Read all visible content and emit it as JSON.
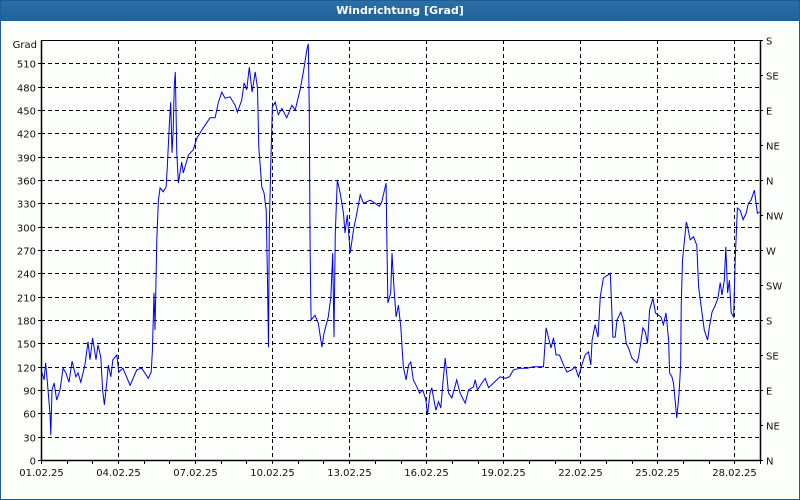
{
  "window": {
    "title": "Windrichtung [Grad]"
  },
  "chart_data": {
    "type": "line",
    "title": "Windrichtung [Grad]",
    "ylabel": "Grad",
    "ylim": [
      0,
      540
    ],
    "yticks": [
      0,
      30,
      60,
      90,
      120,
      150,
      180,
      210,
      240,
      270,
      300,
      330,
      360,
      390,
      420,
      450,
      480,
      510
    ],
    "y2ticks": [
      {
        "value": 0,
        "label": "N"
      },
      {
        "value": 45,
        "label": "NE"
      },
      {
        "value": 90,
        "label": "E"
      },
      {
        "value": 135,
        "label": "SE"
      },
      {
        "value": 180,
        "label": "S"
      },
      {
        "value": 225,
        "label": "SW"
      },
      {
        "value": 270,
        "label": "W"
      },
      {
        "value": 315,
        "label": "NW"
      },
      {
        "value": 360,
        "label": "N"
      },
      {
        "value": 405,
        "label": "NE"
      },
      {
        "value": 450,
        "label": "E"
      },
      {
        "value": 495,
        "label": "SE"
      },
      {
        "value": 540,
        "label": "S"
      }
    ],
    "xlim_days": [
      0,
      28
    ],
    "xticks": [
      {
        "day": 0,
        "label": "01.02.25"
      },
      {
        "day": 3,
        "label": "04.02.25"
      },
      {
        "day": 6,
        "label": "07.02.25"
      },
      {
        "day": 9,
        "label": "10.02.25"
      },
      {
        "day": 12,
        "label": "13.02.25"
      },
      {
        "day": 15,
        "label": "16.02.25"
      },
      {
        "day": 18,
        "label": "19.02.25"
      },
      {
        "day": 21,
        "label": "22.02.25"
      },
      {
        "day": 24,
        "label": "25.02.25"
      },
      {
        "day": 27,
        "label": "28.02.25"
      }
    ],
    "grid": true,
    "line_color": "#0000ee",
    "series": [
      {
        "name": "Windrichtung",
        "points": [
          [
            0.03,
            113
          ],
          [
            0.12,
            103
          ],
          [
            0.18,
            125
          ],
          [
            0.23,
            107
          ],
          [
            0.35,
            60
          ],
          [
            0.38,
            32
          ],
          [
            0.43,
            90
          ],
          [
            0.51,
            99
          ],
          [
            0.61,
            77
          ],
          [
            0.74,
            90
          ],
          [
            0.86,
            118
          ],
          [
            0.97,
            112
          ],
          [
            1.09,
            100
          ],
          [
            1.21,
            127
          ],
          [
            1.36,
            107
          ],
          [
            1.44,
            112
          ],
          [
            1.55,
            100
          ],
          [
            1.71,
            122
          ],
          [
            1.83,
            152
          ],
          [
            1.91,
            129
          ],
          [
            2.01,
            157
          ],
          [
            2.14,
            129
          ],
          [
            2.22,
            148
          ],
          [
            2.33,
            132
          ],
          [
            2.4,
            90
          ],
          [
            2.47,
            71
          ],
          [
            2.56,
            99
          ],
          [
            2.62,
            122
          ],
          [
            2.72,
            107
          ],
          [
            2.8,
            129
          ],
          [
            2.95,
            135
          ],
          [
            3.03,
            113
          ],
          [
            3.19,
            118
          ],
          [
            3.47,
            96
          ],
          [
            3.73,
            116
          ],
          [
            3.92,
            118
          ],
          [
            4.18,
            105
          ],
          [
            4.29,
            113
          ],
          [
            4.34,
            141
          ],
          [
            4.4,
            215
          ],
          [
            4.44,
            167
          ],
          [
            4.51,
            283
          ],
          [
            4.57,
            334
          ],
          [
            4.64,
            350
          ],
          [
            4.76,
            345
          ],
          [
            4.87,
            351
          ],
          [
            4.92,
            377
          ],
          [
            5.0,
            433
          ],
          [
            5.05,
            460
          ],
          [
            5.1,
            395
          ],
          [
            5.15,
            424
          ],
          [
            5.19,
            482
          ],
          [
            5.23,
            499
          ],
          [
            5.29,
            395
          ],
          [
            5.35,
            356
          ],
          [
            5.48,
            383
          ],
          [
            5.54,
            369
          ],
          [
            5.74,
            392
          ],
          [
            5.93,
            399
          ],
          [
            6.07,
            414
          ],
          [
            6.32,
            427
          ],
          [
            6.58,
            440
          ],
          [
            6.78,
            440
          ],
          [
            6.91,
            460
          ],
          [
            7.04,
            473
          ],
          [
            7.17,
            465
          ],
          [
            7.36,
            467
          ],
          [
            7.56,
            456
          ],
          [
            7.65,
            447
          ],
          [
            7.82,
            463
          ],
          [
            7.91,
            485
          ],
          [
            8.01,
            476
          ],
          [
            8.11,
            505
          ],
          [
            8.22,
            473
          ],
          [
            8.34,
            499
          ],
          [
            8.43,
            478
          ],
          [
            8.48,
            402
          ],
          [
            8.6,
            351
          ],
          [
            8.69,
            343
          ],
          [
            8.77,
            321
          ],
          [
            8.82,
            231
          ],
          [
            8.86,
            145
          ],
          [
            8.89,
            300
          ],
          [
            8.95,
            382
          ],
          [
            9.01,
            454
          ],
          [
            9.12,
            460
          ],
          [
            9.24,
            444
          ],
          [
            9.38,
            452
          ],
          [
            9.57,
            440
          ],
          [
            9.77,
            456
          ],
          [
            9.9,
            450
          ],
          [
            10.09,
            476
          ],
          [
            10.22,
            499
          ],
          [
            10.35,
            527
          ],
          [
            10.41,
            535
          ],
          [
            10.45,
            446
          ],
          [
            10.48,
            270
          ],
          [
            10.52,
            180
          ],
          [
            10.67,
            186
          ],
          [
            10.8,
            176
          ],
          [
            10.94,
            145
          ],
          [
            11.02,
            163
          ],
          [
            11.19,
            184
          ],
          [
            11.29,
            210
          ],
          [
            11.36,
            266
          ],
          [
            11.41,
            158
          ],
          [
            11.46,
            292
          ],
          [
            11.54,
            360
          ],
          [
            11.65,
            343
          ],
          [
            11.78,
            317
          ],
          [
            11.84,
            292
          ],
          [
            11.93,
            315
          ],
          [
            12.04,
            266
          ],
          [
            12.17,
            296
          ],
          [
            12.32,
            321
          ],
          [
            12.43,
            341
          ],
          [
            12.56,
            330
          ],
          [
            12.82,
            334
          ],
          [
            13.01,
            330
          ],
          [
            13.18,
            326
          ],
          [
            13.27,
            332
          ],
          [
            13.36,
            345
          ],
          [
            13.44,
            356
          ],
          [
            13.47,
            279
          ],
          [
            13.51,
            202
          ],
          [
            13.62,
            215
          ],
          [
            13.67,
            266
          ],
          [
            13.75,
            219
          ],
          [
            13.83,
            184
          ],
          [
            13.92,
            199
          ],
          [
            14.01,
            171
          ],
          [
            14.11,
            120
          ],
          [
            14.22,
            103
          ],
          [
            14.31,
            122
          ],
          [
            14.4,
            126
          ],
          [
            14.5,
            103
          ],
          [
            14.64,
            94
          ],
          [
            14.74,
            86
          ],
          [
            14.87,
            90
          ],
          [
            14.99,
            77
          ],
          [
            15.05,
            58
          ],
          [
            15.15,
            86
          ],
          [
            15.22,
            93
          ],
          [
            15.28,
            81
          ],
          [
            15.38,
            64
          ],
          [
            15.48,
            75
          ],
          [
            15.57,
            67
          ],
          [
            15.65,
            99
          ],
          [
            15.74,
            131
          ],
          [
            15.87,
            86
          ],
          [
            16.0,
            80
          ],
          [
            16.19,
            103
          ],
          [
            16.32,
            86
          ],
          [
            16.52,
            73
          ],
          [
            16.65,
            90
          ],
          [
            16.84,
            94
          ],
          [
            16.91,
            103
          ],
          [
            17.0,
            90
          ],
          [
            17.17,
            99
          ],
          [
            17.3,
            105
          ],
          [
            17.43,
            93
          ],
          [
            17.62,
            99
          ],
          [
            17.88,
            107
          ],
          [
            18.08,
            105
          ],
          [
            18.24,
            107
          ],
          [
            18.4,
            116
          ],
          [
            18.66,
            118
          ],
          [
            18.92,
            118
          ],
          [
            19.18,
            120
          ],
          [
            19.44,
            120
          ],
          [
            19.57,
            120
          ],
          [
            19.67,
            170
          ],
          [
            19.76,
            158
          ],
          [
            19.86,
            144
          ],
          [
            19.96,
            157
          ],
          [
            20.06,
            135
          ],
          [
            20.19,
            135
          ],
          [
            20.35,
            122
          ],
          [
            20.48,
            113
          ],
          [
            20.67,
            116
          ],
          [
            20.8,
            120
          ],
          [
            20.93,
            107
          ],
          [
            21.06,
            122
          ],
          [
            21.19,
            135
          ],
          [
            21.32,
            139
          ],
          [
            21.41,
            122
          ],
          [
            21.46,
            154
          ],
          [
            21.58,
            174
          ],
          [
            21.69,
            158
          ],
          [
            21.78,
            210
          ],
          [
            21.9,
            234
          ],
          [
            22.17,
            240
          ],
          [
            22.27,
            158
          ],
          [
            22.36,
            158
          ],
          [
            22.43,
            180
          ],
          [
            22.58,
            190
          ],
          [
            22.68,
            180
          ],
          [
            22.79,
            150
          ],
          [
            22.88,
            144
          ],
          [
            23.01,
            131
          ],
          [
            23.21,
            125
          ],
          [
            23.27,
            132
          ],
          [
            23.36,
            152
          ],
          [
            23.44,
            170
          ],
          [
            23.53,
            165
          ],
          [
            23.62,
            150
          ],
          [
            23.7,
            193
          ],
          [
            23.83,
            208
          ],
          [
            23.93,
            189
          ],
          [
            24.05,
            186
          ],
          [
            24.14,
            184
          ],
          [
            24.24,
            174
          ],
          [
            24.34,
            189
          ],
          [
            24.44,
            154
          ],
          [
            24.48,
            112
          ],
          [
            24.57,
            107
          ],
          [
            24.63,
            99
          ],
          [
            24.73,
            64
          ],
          [
            24.76,
            54
          ],
          [
            24.85,
            86
          ],
          [
            24.91,
            124
          ],
          [
            24.93,
            197
          ],
          [
            24.98,
            257
          ],
          [
            25.06,
            283
          ],
          [
            25.13,
            306
          ],
          [
            25.18,
            300
          ],
          [
            25.28,
            283
          ],
          [
            25.41,
            287
          ],
          [
            25.54,
            276
          ],
          [
            25.61,
            223
          ],
          [
            25.71,
            197
          ],
          [
            25.83,
            167
          ],
          [
            25.96,
            154
          ],
          [
            26.03,
            171
          ],
          [
            26.13,
            190
          ],
          [
            26.26,
            199
          ],
          [
            26.36,
            208
          ],
          [
            26.45,
            228
          ],
          [
            26.52,
            212
          ],
          [
            26.61,
            231
          ],
          [
            26.67,
            274
          ],
          [
            26.74,
            215
          ],
          [
            26.81,
            231
          ],
          [
            26.88,
            189
          ],
          [
            26.97,
            184
          ],
          [
            27.04,
            261
          ],
          [
            27.12,
            324
          ],
          [
            27.23,
            321
          ],
          [
            27.34,
            309
          ],
          [
            27.46,
            317
          ],
          [
            27.55,
            330
          ],
          [
            27.65,
            334
          ],
          [
            27.78,
            347
          ],
          [
            27.85,
            330
          ],
          [
            27.9,
            317
          ],
          [
            27.98,
            319
          ]
        ]
      }
    ]
  }
}
